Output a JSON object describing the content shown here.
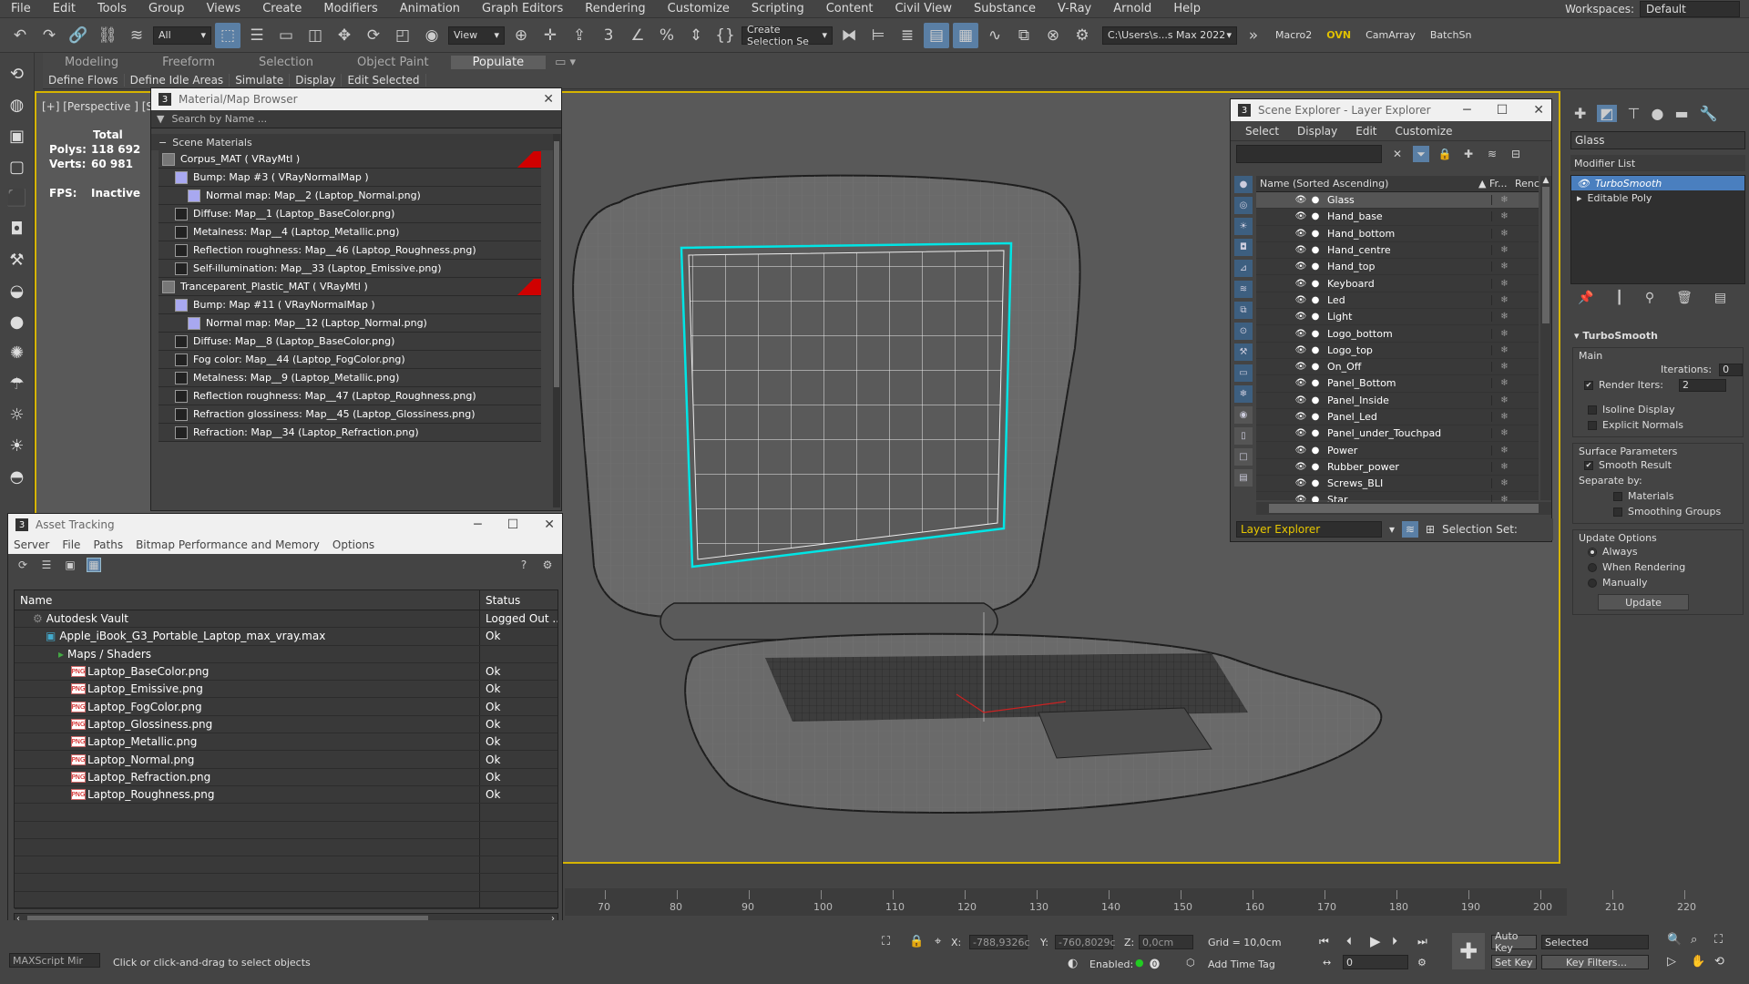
{
  "menu": [
    "File",
    "Edit",
    "Tools",
    "Group",
    "Views",
    "Create",
    "Modifiers",
    "Animation",
    "Graph Editors",
    "Rendering",
    "Customize",
    "Scripting",
    "Content",
    "Civil View",
    "Substance",
    "V-Ray",
    "Arnold",
    "Help"
  ],
  "workspaces": {
    "label": "Workspaces:",
    "value": "Default"
  },
  "toolbar": {
    "filter": "All",
    "view": "View",
    "selection_set": "Create Selection Se",
    "path": "C:\\Users\\s...s Max 2022",
    "macro": "Macro2",
    "ovn": "OVN",
    "camarray": "CamArray",
    "batch": "BatchSn"
  },
  "ribbon": {
    "tabs": [
      "Modeling",
      "Freeform",
      "Selection",
      "Object Paint",
      "Populate"
    ],
    "active": "Populate",
    "subs": [
      "Define Flows",
      "Define Idle Areas",
      "Simulate",
      "Display",
      "Edit Selected"
    ]
  },
  "viewport": {
    "label": "[+] [Perspective ] [St",
    "stats": {
      "total": "Total",
      "polys_label": "Polys:",
      "polys": "118 692",
      "verts_label": "Verts:",
      "verts": "60 981",
      "fps_label": "FPS:",
      "fps": "Inactive"
    }
  },
  "material_browser": {
    "title": "Material/Map Browser",
    "search": "Search by Name ...",
    "section": "Scene Materials",
    "rows": [
      {
        "text": "Corpus_MAT ( VRayMtl )",
        "level": 0,
        "red": true
      },
      {
        "text": "Bump: Map #3 ( VRayNormalMap )",
        "level": 1
      },
      {
        "text": "Normal map: Map__2 (Laptop_Normal.png)",
        "level": 2
      },
      {
        "text": "Diffuse: Map__1 (Laptop_BaseColor.png)",
        "level": 1
      },
      {
        "text": "Metalness: Map__4 (Laptop_Metallic.png)",
        "level": 1
      },
      {
        "text": "Reflection roughness: Map__46 (Laptop_Roughness.png)",
        "level": 1
      },
      {
        "text": "Self-illumination: Map__33 (Laptop_Emissive.png)",
        "level": 1
      },
      {
        "text": "Tranceparent_Plastic_MAT ( VRayMtl )",
        "level": 0,
        "red": true
      },
      {
        "text": "Bump: Map #11 ( VRayNormalMap )",
        "level": 1
      },
      {
        "text": "Normal map: Map__12 (Laptop_Normal.png)",
        "level": 2
      },
      {
        "text": "Diffuse: Map__8 (Laptop_BaseColor.png)",
        "level": 1
      },
      {
        "text": "Fog color: Map__44 (Laptop_FogColor.png)",
        "level": 1
      },
      {
        "text": "Metalness: Map__9 (Laptop_Metallic.png)",
        "level": 1
      },
      {
        "text": "Reflection roughness: Map__47 (Laptop_Roughness.png)",
        "level": 1
      },
      {
        "text": "Refraction glossiness: Map__45 (Laptop_Glossiness.png)",
        "level": 1
      },
      {
        "text": "Refraction: Map__34 (Laptop_Refraction.png)",
        "level": 1
      }
    ]
  },
  "asset_tracking": {
    "title": "Asset Tracking",
    "menu": [
      "Server",
      "File",
      "Paths",
      "Bitmap Performance and Memory",
      "Options"
    ],
    "headers": [
      "Name",
      "Status"
    ],
    "rows": [
      {
        "name": "Autodesk Vault",
        "status": "Logged Out ...",
        "level": 1,
        "icon": "vault"
      },
      {
        "name": "Apple_iBook_G3_Portable_Laptop_max_vray.max",
        "status": "Ok",
        "level": 2,
        "icon": "max"
      },
      {
        "name": "Maps / Shaders",
        "status": "",
        "level": 3,
        "icon": "folder"
      },
      {
        "name": "Laptop_BaseColor.png",
        "status": "Ok",
        "level": 4,
        "icon": "png"
      },
      {
        "name": "Laptop_Emissive.png",
        "status": "Ok",
        "level": 4,
        "icon": "png"
      },
      {
        "name": "Laptop_FogColor.png",
        "status": "Ok",
        "level": 4,
        "icon": "png"
      },
      {
        "name": "Laptop_Glossiness.png",
        "status": "Ok",
        "level": 4,
        "icon": "png"
      },
      {
        "name": "Laptop_Metallic.png",
        "status": "Ok",
        "level": 4,
        "icon": "png"
      },
      {
        "name": "Laptop_Normal.png",
        "status": "Ok",
        "level": 4,
        "icon": "png"
      },
      {
        "name": "Laptop_Refraction.png",
        "status": "Ok",
        "level": 4,
        "icon": "png"
      },
      {
        "name": "Laptop_Roughness.png",
        "status": "Ok",
        "level": 4,
        "icon": "png"
      }
    ]
  },
  "scene_explorer": {
    "title": "Scene Explorer - Layer Explorer",
    "menu": [
      "Select",
      "Display",
      "Edit",
      "Customize"
    ],
    "col_name": "Name (Sorted Ascending)",
    "col_fr": "▲ Fr...",
    "col_ren": "Renc",
    "items": [
      "Glass",
      "Hand_base",
      "Hand_bottom",
      "Hand_centre",
      "Hand_top",
      "Keyboard",
      "Led",
      "Light",
      "Logo_bottom",
      "Logo_top",
      "On_Off",
      "Panel_Bottom",
      "Panel_Inside",
      "Panel_Led",
      "Panel_under_Touchpad",
      "Power",
      "Rubber_power",
      "Screws_BLI",
      "Star"
    ],
    "selected": "Glass",
    "layer_explorer": "Layer Explorer",
    "selection_set": "Selection Set:"
  },
  "command_panel": {
    "object_name": "Glass",
    "modifier_list": "Modifier List",
    "stack": [
      "TurboSmooth",
      "Editable Poly"
    ],
    "turbosmooth": {
      "title": "TurboSmooth",
      "main": "Main",
      "iterations_label": "Iterations:",
      "iterations": "0",
      "render_iters_label": "Render Iters:",
      "render_iters": "2",
      "isoline": "Isoline Display",
      "explicit": "Explicit Normals",
      "surface": "Surface Parameters",
      "smooth_result": "Smooth Result",
      "separate": "Separate by:",
      "materials": "Materials",
      "smoothing_groups": "Smoothing Groups",
      "update_options": "Update Options",
      "always": "Always",
      "when_rendering": "When Rendering",
      "manually": "Manually",
      "update": "Update"
    }
  },
  "timeline": {
    "ticks": [
      "70",
      "80",
      "90",
      "100",
      "110",
      "120",
      "130",
      "140",
      "150",
      "160",
      "170",
      "180",
      "190",
      "200",
      "210",
      "220"
    ]
  },
  "statusbar": {
    "maxscript": "MAXScript Mir",
    "prompt": "Click or click-and-drag to select objects",
    "x_label": "X:",
    "x": "-788,9326c",
    "y_label": "Y:",
    "y": "-760,8029c",
    "z_label": "Z:",
    "z": "0,0cm",
    "grid": "Grid = 10,0cm",
    "enabled": "Enabled:",
    "add_time_tag": "Add Time Tag",
    "auto_key": "Auto Key",
    "selected": "Selected",
    "set_key": "Set Key",
    "key_filters": "Key Filters...",
    "frame": "0"
  }
}
